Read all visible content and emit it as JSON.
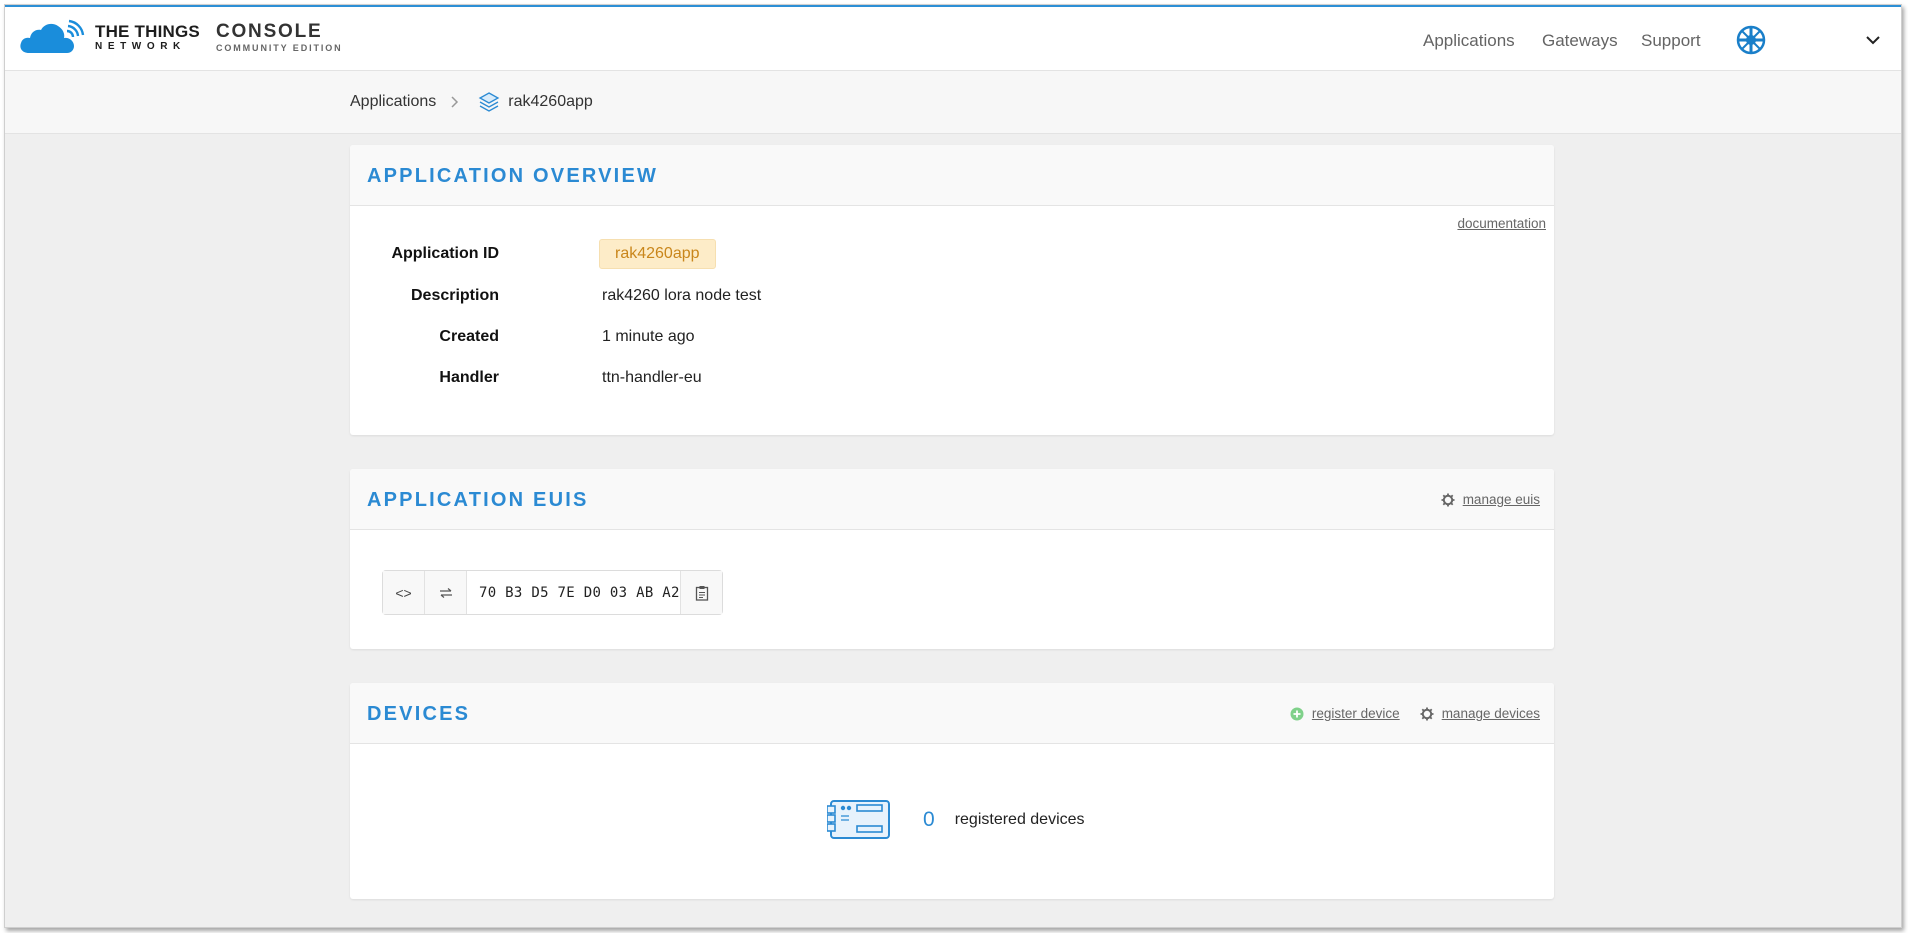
{
  "header": {
    "brand_line1": "THE THINGS",
    "brand_line2": "NETWORK",
    "console_line1": "CONSOLE",
    "console_line2": "COMMUNITY EDITION",
    "nav": [
      {
        "label": "Applications"
      },
      {
        "label": "Gateways"
      },
      {
        "label": "Support"
      }
    ],
    "accent_color": "#2b8ad3"
  },
  "breadcrumb": {
    "items": [
      {
        "label": "Applications"
      },
      {
        "label": "rak4260app",
        "icon": "layers-icon"
      }
    ]
  },
  "overview": {
    "title": "APPLICATION OVERVIEW",
    "documentation_link": "documentation",
    "fields": [
      {
        "label": "Application ID",
        "value": "rak4260app"
      },
      {
        "label": "Description",
        "value": "rak4260 lora node test"
      },
      {
        "label": "Created",
        "value": "1 minute ago"
      },
      {
        "label": "Handler",
        "value": "ttn-handler-eu"
      }
    ]
  },
  "euis": {
    "title": "APPLICATION EUIS",
    "manage_link": "manage euis",
    "eui_value": "70 B3 D5 7E D0 03 AB A2"
  },
  "devices": {
    "title": "DEVICES",
    "register_link": "register device",
    "manage_link": "manage devices",
    "count": "0",
    "count_label": "registered devices"
  }
}
